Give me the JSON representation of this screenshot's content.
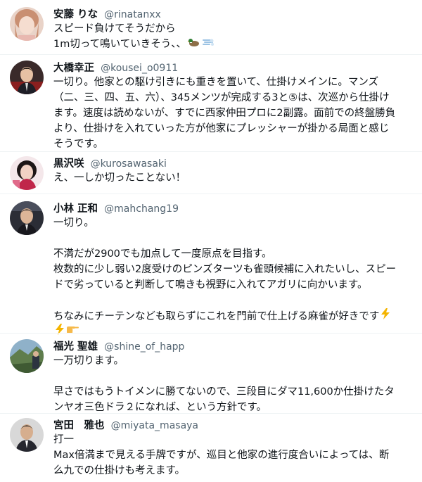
{
  "tweets": [
    {
      "name": "安藤 りな",
      "handle": "@rinatanxx",
      "lines": [
        "スピード負けてそうだから",
        "1m切って鳴いていきそう、、"
      ],
      "emoji": [
        "duck-emoji",
        "dash-emoji"
      ]
    },
    {
      "name": "大橋幸正",
      "handle": "@kousei_o0911",
      "lines": [
        "一切り。他家との駆け引きにも重きを置いて、仕掛けメインに。マンズ",
        "（二、三、四、五、六）、345メンツが完成する3と⑤は、次巡から仕掛け",
        "ます。速度は読めないが、すでに西家仲田プロに2副露。面前での終盤勝負",
        "より、仕掛けを入れていった方が他家にプレッシャーが掛かる局面と感じ",
        "そうです。"
      ]
    },
    {
      "name": "黒沢咲",
      "handle": "@kurosawasaki",
      "lines": [
        "え、一しか切ったことない！"
      ]
    },
    {
      "name": "小林 正和",
      "handle": "@mahchang19",
      "lines": [
        "一切り。",
        "",
        "不満だが2900でも加点して一度原点を目指す。",
        "枚数的に少し弱い2度受けのピンズターツも雀頭候補に入れたいし、スピー",
        "ドで劣っていると判断して鳴きも視野に入れてアガリに向かいます。",
        "",
        "ちなみにチーテンなども取らずにこれを門前で仕上げる麻雀が好きです"
      ],
      "emoji": [
        "lightning-emoji",
        "lightning-emoji",
        "pointing-hand-emoji"
      ]
    },
    {
      "name": "福光 聖雄",
      "handle": "@shine_of_happ",
      "lines": [
        "一万切ります。",
        "",
        "早さではもうトイメンに勝てないので、三段目にダマ11,600か仕掛けたタ",
        "ンヤオ三色ドラ２になれば、という方針です。"
      ]
    },
    {
      "name": "宮田　雅也",
      "handle": "@miyata_masaya",
      "lines": [
        "打一",
        "Max倍満まで見える手牌ですが、巡目と他家の進行度合いによっては、断",
        "么九での仕掛けも考えます。"
      ]
    }
  ],
  "colors": {
    "name": "#0f1419",
    "handle": "#536471",
    "divider": "#eff3f4"
  }
}
